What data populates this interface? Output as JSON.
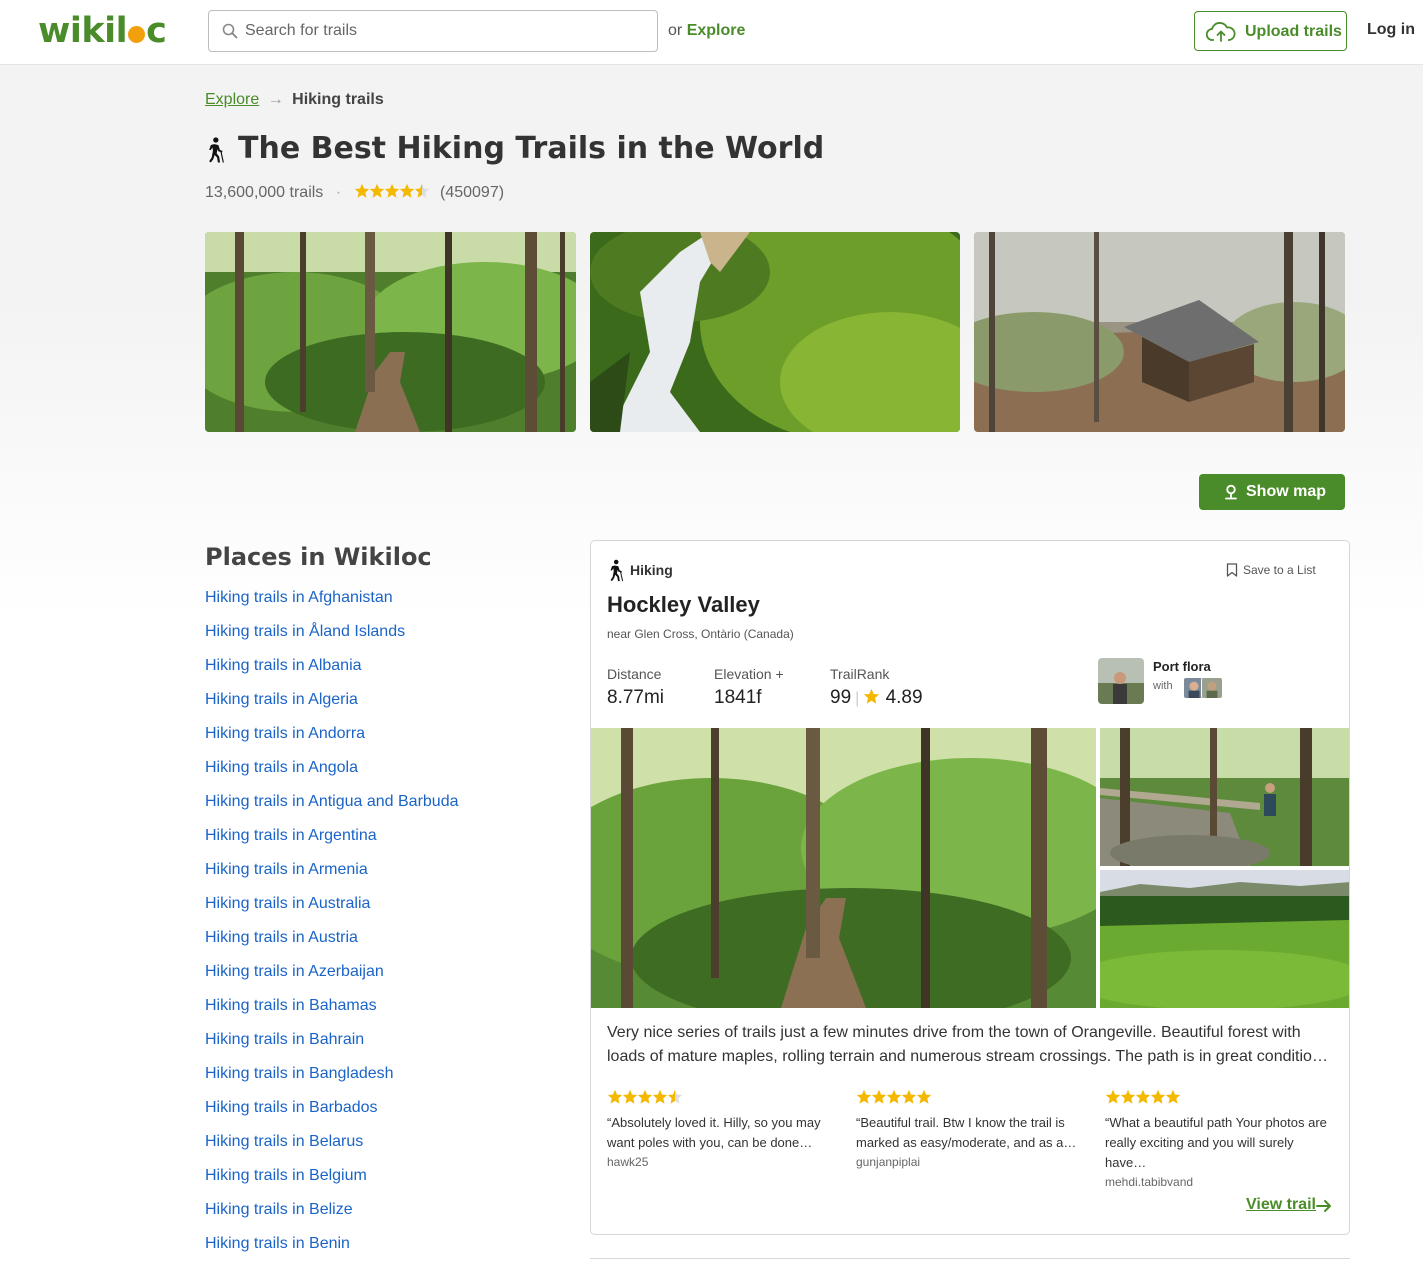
{
  "header": {
    "logo": "wikiloc",
    "search_placeholder": "Search for trails",
    "or_text": "or",
    "explore_label": "Explore",
    "upload_label": "Upload trails",
    "login_label": "Log in"
  },
  "breadcrumb": {
    "parent": "Explore",
    "current": "Hiking trails"
  },
  "page": {
    "title": "The Best Hiking Trails in the World",
    "trail_count": "13,600,000 trails",
    "rating_stars": 4.5,
    "review_count": "(450097)",
    "show_map_label": "Show map"
  },
  "places": {
    "title": "Places in Wikiloc",
    "items": [
      "Hiking trails in Afghanistan",
      "Hiking trails in Åland Islands",
      "Hiking trails in Albania",
      "Hiking trails in Algeria",
      "Hiking trails in Andorra",
      "Hiking trails in Angola",
      "Hiking trails in Antigua and Barbuda",
      "Hiking trails in Argentina",
      "Hiking trails in Armenia",
      "Hiking trails in Australia",
      "Hiking trails in Austria",
      "Hiking trails in Azerbaijan",
      "Hiking trails in Bahamas",
      "Hiking trails in Bahrain",
      "Hiking trails in Bangladesh",
      "Hiking trails in Barbados",
      "Hiking trails in Belarus",
      "Hiking trails in Belgium",
      "Hiking trails in Belize",
      "Hiking trails in Benin"
    ]
  },
  "trail_card": {
    "activity": "Hiking",
    "save_label": "Save to a List",
    "name": "Hockley Valley",
    "location": "near Glen Cross, Ontàrio (Canada)",
    "distance_label": "Distance",
    "distance_value": "8.77mi",
    "elevation_label": "Elevation +",
    "elevation_value": "1841f",
    "trailrank_label": "TrailRank",
    "trailrank_value": "99",
    "rating_value": "4.89",
    "author": "Port flora",
    "with_label": "with",
    "description": "Very nice series of trails just a few minutes drive from the town of Orangeville. Beautiful forest with loads of mature maples, rolling terrain and numerous stream crossings. The path is in great conditio…",
    "reviews": [
      {
        "stars": 4.5,
        "text": "“Absolutely loved it. Hilly, so you may want poles with you, can be done…",
        "user": "hawk25"
      },
      {
        "stars": 5,
        "text": "“Beautiful trail. Btw I know the trail is marked as easy/moderate, and as a…",
        "user": "gunjanpiplai"
      },
      {
        "stars": 5,
        "text": "“What a beautiful path Your photos are really exciting and you will surely have…",
        "user": "mehdi.tabibvand"
      }
    ],
    "view_label": "View trail"
  },
  "colors": {
    "brand_green": "#4a8c2a",
    "link_blue": "#1a64c8",
    "star_yellow": "#f5b800",
    "logo_orange": "#f2a10c"
  }
}
